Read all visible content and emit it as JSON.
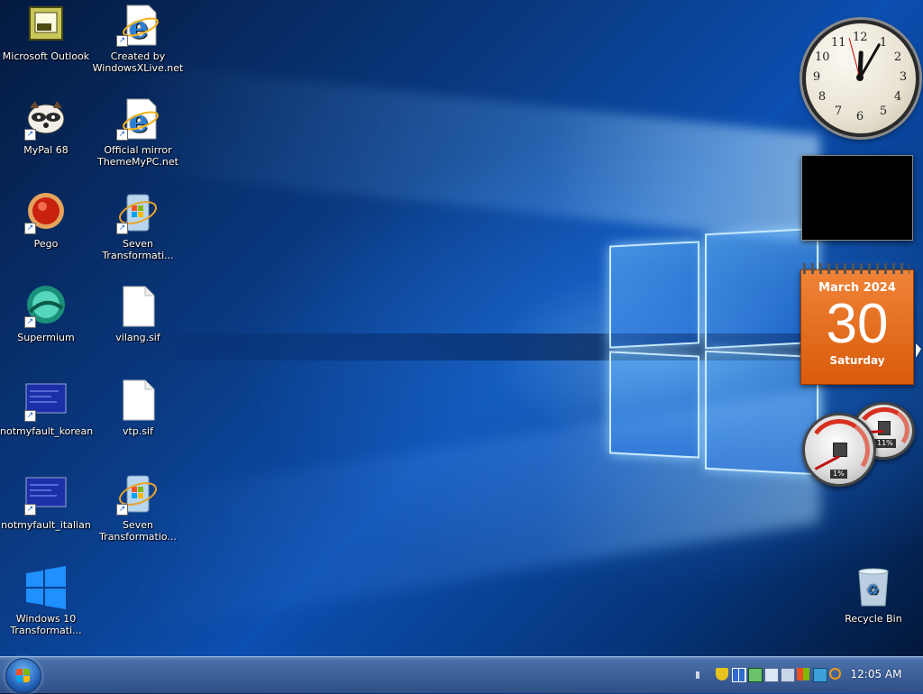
{
  "desktop": {
    "icons": [
      {
        "label": "Microsoft Outlook",
        "icon": "outlook-icon"
      },
      {
        "label": "Created by WindowsXLive.net",
        "icon": "internet-explorer-icon"
      },
      {
        "label": "MyPal 68",
        "icon": "mypal-browser-icon"
      },
      {
        "label": "Official mirror ThemeMyPC.net",
        "icon": "internet-explorer-icon"
      },
      {
        "label": "Pego",
        "icon": "pego-icon"
      },
      {
        "label": "Seven Transformati...",
        "icon": "installer-icon"
      },
      {
        "label": "Supermium",
        "icon": "supermium-icon"
      },
      {
        "label": "vilang.sif",
        "icon": "document-icon"
      },
      {
        "label": "notmyfault_korean",
        "icon": "notmyfault-icon"
      },
      {
        "label": "vtp.sif",
        "icon": "document-icon"
      },
      {
        "label": "notmyfault_italian",
        "icon": "notmyfault-icon"
      },
      {
        "label": "Seven Transformatio...",
        "icon": "installer-icon"
      },
      {
        "label": "Windows 10 Transformati...",
        "icon": "windows-logo-icon"
      },
      {
        "label": "Recycle Bin",
        "icon": "recycle-bin-icon"
      }
    ]
  },
  "gadgets": {
    "clock": {
      "numbers": [
        "12",
        "1",
        "2",
        "3",
        "4",
        "5",
        "6",
        "7",
        "8",
        "9",
        "10",
        "11"
      ],
      "hour": 12,
      "minute": 5
    },
    "calendar": {
      "month_year": "March 2024",
      "day": "30",
      "weekday": "Saturday"
    },
    "cpu_meter": {
      "cpu_percent": "1%",
      "memory_percent": "11%",
      "cpu_fraction": 0.01,
      "memory_fraction": 0.11
    }
  },
  "taskbar": {
    "start_icon": "windows-orb-icon",
    "tray_icons": [
      "security-shield-icon",
      "network-icon",
      "display-icon",
      "monitor-icon",
      "volume-icon",
      "flag-icon",
      "tablet-icon",
      "search-icon"
    ],
    "time": "12:05 AM"
  },
  "colors": {
    "accent": "#0b4fb0",
    "calendar": "#e0641a",
    "taskbar": "#3c5f98"
  }
}
